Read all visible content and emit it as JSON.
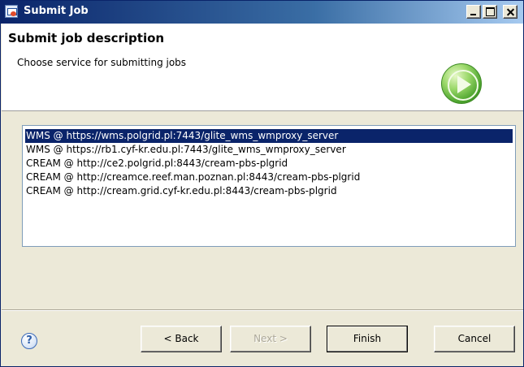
{
  "window": {
    "title": "Submit Job"
  },
  "header": {
    "title": "Submit job description",
    "subtitle": "Choose service for submitting jobs",
    "icon": "play-icon"
  },
  "services": [
    "WMS @ https://wms.polgrid.pl:7443/glite_wms_wmproxy_server",
    "WMS @ https://rb1.cyf-kr.edu.pl:7443/glite_wms_wmproxy_server",
    "CREAM @ http://ce2.polgrid.pl:8443/cream-pbs-plgrid",
    "CREAM @ http://creamce.reef.man.poznan.pl:8443/cream-pbs-plgrid",
    "CREAM @ http://cream.grid.cyf-kr.edu.pl:8443/cream-pbs-plgrid"
  ],
  "selected_index": 0,
  "footer": {
    "help_glyph": "?",
    "back_label": "< Back",
    "next_label": "Next >",
    "finish_label": "Finish",
    "cancel_label": "Cancel"
  },
  "colors": {
    "selection": "#0a246a",
    "dialog_bg": "#ece9d8"
  }
}
